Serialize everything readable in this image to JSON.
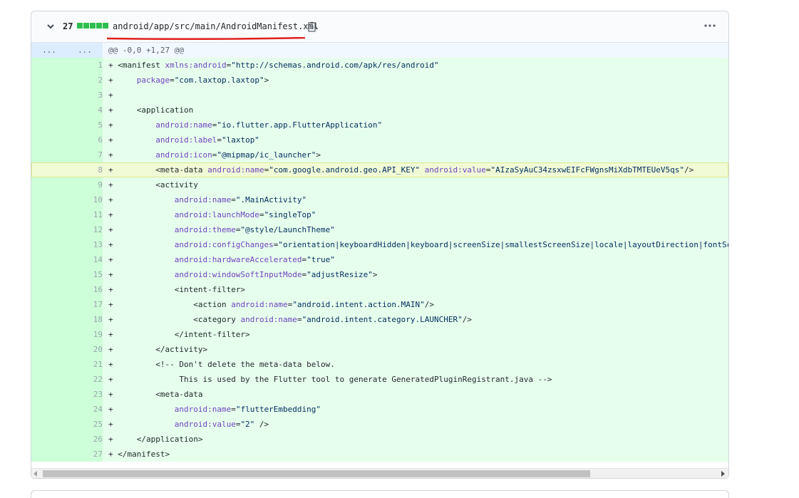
{
  "file": {
    "changes_count": "27",
    "diffstat_color": "#2cbe4e",
    "path": "android/app/src/main/AndroidManifest.xml",
    "underline_color": "#e0201c",
    "icons": {
      "expand": "chevron-down-icon",
      "copy": "clipboard-copy-icon",
      "more": "kebab-horizontal-icon"
    }
  },
  "hunk": {
    "ln_old": "...",
    "ln_new": "...",
    "header": "@@ -0,0 +1,27 @@"
  },
  "lines": [
    {
      "n": "1",
      "t": [
        [
          "p",
          "+ "
        ],
        [
          "g",
          "<manifest "
        ],
        [
          "a",
          "xmlns:android"
        ],
        [
          "g",
          "="
        ],
        [
          "s",
          "\"http://schemas.android.com/apk/res/android\""
        ]
      ]
    },
    {
      "n": "2",
      "t": [
        [
          "p",
          "+     "
        ],
        [
          "a",
          "package"
        ],
        [
          "g",
          "="
        ],
        [
          "s",
          "\"com.laxtop.laxtop\""
        ],
        [
          "g",
          ">"
        ]
      ]
    },
    {
      "n": "3",
      "t": [
        [
          "p",
          "+"
        ]
      ]
    },
    {
      "n": "4",
      "t": [
        [
          "p",
          "+     "
        ],
        [
          "g",
          "<application"
        ]
      ]
    },
    {
      "n": "5",
      "t": [
        [
          "p",
          "+         "
        ],
        [
          "a",
          "android:name"
        ],
        [
          "g",
          "="
        ],
        [
          "s",
          "\"io.flutter.app.FlutterApplication\""
        ]
      ]
    },
    {
      "n": "6",
      "t": [
        [
          "p",
          "+         "
        ],
        [
          "a",
          "android:label"
        ],
        [
          "g",
          "="
        ],
        [
          "s",
          "\"laxtop\""
        ]
      ]
    },
    {
      "n": "7",
      "t": [
        [
          "p",
          "+         "
        ],
        [
          "a",
          "android:icon"
        ],
        [
          "g",
          "="
        ],
        [
          "s",
          "\"@mipmap/ic_launcher\""
        ],
        [
          "g",
          ">"
        ]
      ]
    },
    {
      "n": "8",
      "hl": true,
      "t": [
        [
          "p",
          "+         "
        ],
        [
          "g",
          "<meta-data "
        ],
        [
          "a",
          "android:name"
        ],
        [
          "g",
          "="
        ],
        [
          "s",
          "\"com.google.android.geo.API_KEY\""
        ],
        [
          "g",
          " "
        ],
        [
          "a",
          "android:value"
        ],
        [
          "g",
          "="
        ],
        [
          "s",
          "\"AIzaSyAuC34zsxwEIFcFWgnsMiXdbTMTEUeV5qs\""
        ],
        [
          "g",
          "/>"
        ]
      ]
    },
    {
      "n": "9",
      "t": [
        [
          "p",
          "+         "
        ],
        [
          "g",
          "<activity"
        ]
      ]
    },
    {
      "n": "10",
      "t": [
        [
          "p",
          "+             "
        ],
        [
          "a",
          "android:name"
        ],
        [
          "g",
          "="
        ],
        [
          "s",
          "\".MainActivity\""
        ]
      ]
    },
    {
      "n": "11",
      "t": [
        [
          "p",
          "+             "
        ],
        [
          "a",
          "android:launchMode"
        ],
        [
          "g",
          "="
        ],
        [
          "s",
          "\"singleTop\""
        ]
      ]
    },
    {
      "n": "12",
      "t": [
        [
          "p",
          "+             "
        ],
        [
          "a",
          "android:theme"
        ],
        [
          "g",
          "="
        ],
        [
          "s",
          "\"@style/LaunchTheme\""
        ]
      ]
    },
    {
      "n": "13",
      "t": [
        [
          "p",
          "+             "
        ],
        [
          "a",
          "android:configChanges"
        ],
        [
          "g",
          "="
        ],
        [
          "s",
          "\"orientation|keyboardHidden|keyboard|screenSize|smallestScreenSize|locale|layoutDirection|fontSc"
        ]
      ]
    },
    {
      "n": "14",
      "t": [
        [
          "p",
          "+             "
        ],
        [
          "a",
          "android:hardwareAccelerated"
        ],
        [
          "g",
          "="
        ],
        [
          "s",
          "\"true\""
        ]
      ]
    },
    {
      "n": "15",
      "t": [
        [
          "p",
          "+             "
        ],
        [
          "a",
          "android:windowSoftInputMode"
        ],
        [
          "g",
          "="
        ],
        [
          "s",
          "\"adjustResize\""
        ],
        [
          "g",
          ">"
        ]
      ]
    },
    {
      "n": "16",
      "t": [
        [
          "p",
          "+             "
        ],
        [
          "g",
          "<intent-filter>"
        ]
      ]
    },
    {
      "n": "17",
      "t": [
        [
          "p",
          "+                 "
        ],
        [
          "g",
          "<action "
        ],
        [
          "a",
          "android:name"
        ],
        [
          "g",
          "="
        ],
        [
          "s",
          "\"android.intent.action.MAIN\""
        ],
        [
          "g",
          "/>"
        ]
      ]
    },
    {
      "n": "18",
      "t": [
        [
          "p",
          "+                 "
        ],
        [
          "g",
          "<category "
        ],
        [
          "a",
          "android:name"
        ],
        [
          "g",
          "="
        ],
        [
          "s",
          "\"android.intent.category.LAUNCHER\""
        ],
        [
          "g",
          "/>"
        ]
      ]
    },
    {
      "n": "19",
      "t": [
        [
          "p",
          "+             "
        ],
        [
          "g",
          "</intent-filter>"
        ]
      ]
    },
    {
      "n": "20",
      "t": [
        [
          "p",
          "+         "
        ],
        [
          "g",
          "</activity>"
        ]
      ]
    },
    {
      "n": "21",
      "t": [
        [
          "p",
          "+         "
        ],
        [
          "c",
          "<!-- Don't delete the meta-data below."
        ]
      ]
    },
    {
      "n": "22",
      "t": [
        [
          "p",
          "+              "
        ],
        [
          "c",
          "This is used by the Flutter tool to generate GeneratedPluginRegistrant.java -->"
        ]
      ]
    },
    {
      "n": "23",
      "t": [
        [
          "p",
          "+         "
        ],
        [
          "g",
          "<meta-data"
        ]
      ]
    },
    {
      "n": "24",
      "t": [
        [
          "p",
          "+             "
        ],
        [
          "a",
          "android:name"
        ],
        [
          "g",
          "="
        ],
        [
          "s",
          "\"flutterEmbedding\""
        ]
      ]
    },
    {
      "n": "25",
      "t": [
        [
          "p",
          "+             "
        ],
        [
          "a",
          "android:value"
        ],
        [
          "g",
          "="
        ],
        [
          "s",
          "\"2\""
        ],
        [
          "g",
          " />"
        ]
      ]
    },
    {
      "n": "26",
      "t": [
        [
          "p",
          "+     "
        ],
        [
          "g",
          "</application>"
        ]
      ]
    },
    {
      "n": "27",
      "t": [
        [
          "p",
          "+ "
        ],
        [
          "g",
          "</manifest>"
        ]
      ]
    }
  ]
}
